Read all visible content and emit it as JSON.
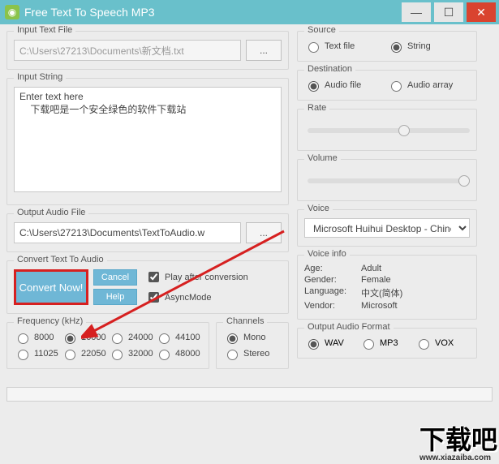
{
  "title": "Free Text To Speech MP3",
  "inputTextFile": {
    "legend": "Input Text File",
    "path": "C:\\Users\\27213\\Documents\\新文档.txt",
    "browse": "..."
  },
  "inputString": {
    "legend": "Input String",
    "placeholder": "Enter text here",
    "value": "Enter text here\n    下载吧是一个安全绿色的软件下载站"
  },
  "outputAudioFile": {
    "legend": "Output Audio File",
    "path": "C:\\Users\\27213\\Documents\\TextToAudio.w",
    "browse": "..."
  },
  "convert": {
    "legend": "Convert Text To Audio",
    "convertNow": "Convert Now!",
    "cancel": "Cancel",
    "help": "Help",
    "playAfter": "Play after conversion",
    "asyncMode": "AsyncMode"
  },
  "frequency": {
    "legend": "Frequency (kHz)",
    "opts": [
      "8000",
      "16000",
      "24000",
      "44100",
      "11025",
      "22050",
      "32000",
      "48000"
    ],
    "selected": "16000"
  },
  "channels": {
    "legend": "Channels",
    "opts": [
      "Mono",
      "Stereo"
    ],
    "selected": "Mono"
  },
  "source": {
    "legend": "Source",
    "opts": [
      "Text file",
      "String"
    ],
    "selected": "String"
  },
  "destination": {
    "legend": "Destination",
    "opts": [
      "Audio file",
      "Audio array"
    ],
    "selected": "Audio file"
  },
  "rate": {
    "legend": "Rate",
    "value": 60
  },
  "volume": {
    "legend": "Volume",
    "value": 100
  },
  "voice": {
    "legend": "Voice",
    "value": "Microsoft Huihui Desktop - Chinese (Sim"
  },
  "voiceInfo": {
    "legend": "Voice info",
    "ageLbl": "Age:",
    "age": "Adult",
    "genderLbl": "Gender:",
    "gender": "Female",
    "langLbl": "Language:",
    "lang": "中文(简体)",
    "vendorLbl": "Vendor:",
    "vendor": "Microsoft"
  },
  "outputFormat": {
    "legend": "Output Audio Format",
    "opts": [
      "WAV",
      "MP3",
      "VOX"
    ],
    "selected": "WAV"
  },
  "watermark": "下载吧",
  "watermarkUrl": "www.xiazaiba.com"
}
